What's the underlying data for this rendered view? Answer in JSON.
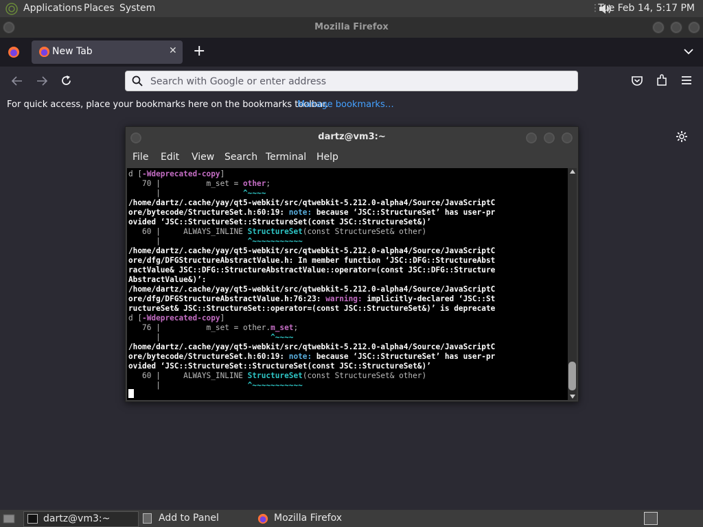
{
  "top_panel": {
    "applications": "Applications",
    "places": "Places",
    "system": "System",
    "clock": "Tue Feb 14,  5:17 PM"
  },
  "firefox": {
    "window_title": "Mozilla Firefox",
    "tab_label": "New Tab",
    "url_placeholder": "Search with Google or enter address",
    "bookmarks_text": "For quick access, place your bookmarks here on the bookmarks toolbar.",
    "manage_bookmarks": "Manage bookmarks…"
  },
  "terminal": {
    "title": "dartz@vm3:~",
    "menu": [
      "File",
      "Edit",
      "View",
      "Search",
      "Terminal",
      "Help"
    ],
    "lines": [
      "d [-Wdeprecated-copy]",
      "   70 |          m_set = other;",
      "      |                  ^~~~~",
      "/home/dartz/.cache/yay/qt5-webkit/src/qtwebkit-5.212.0-alpha4/Source/JavaScriptC",
      "ore/bytecode/StructureSet.h:60:19: note: because ‘JSC::StructureSet’ has user-pr",
      "ovided ‘JSC::StructureSet::StructureSet(const JSC::StructureSet&)’",
      "   60 |     ALWAYS_INLINE StructureSet(const StructureSet& other)",
      "      |                   ^~~~~~~~~~~~",
      "/home/dartz/.cache/yay/qt5-webkit/src/qtwebkit-5.212.0-alpha4/Source/JavaScriptC",
      "ore/dfg/DFGStructureAbstractValue.h: In member function ‘JSC::DFG::StructureAbst",
      "ractValue& JSC::DFG::StructureAbstractValue::operator=(const JSC::DFG::Structure",
      "AbstractValue&)’:",
      "/home/dartz/.cache/yay/qt5-webkit/src/qtwebkit-5.212.0-alpha4/Source/JavaScriptC",
      "ore/dfg/DFGStructureAbstractValue.h:76:23: warning: implicitly-declared ‘JSC::St",
      "ructureSet& JSC::StructureSet::operator=(const JSC::StructureSet&)’ is deprecate",
      "d [-Wdeprecated-copy]",
      "   76 |          m_set = other.m_set;",
      "      |                        ^~~~~",
      "/home/dartz/.cache/yay/qt5-webkit/src/qtwebkit-5.212.0-alpha4/Source/JavaScriptC",
      "ore/bytecode/StructureSet.h:60:19: note: because ‘JSC::StructureSet’ has user-pr",
      "ovided ‘JSC::StructureSet::StructureSet(const JSC::StructureSet&)’",
      "   60 |     ALWAYS_INLINE StructureSet(const StructureSet& other)",
      "      |                   ^~~~~~~~~~~~"
    ]
  },
  "bottom_panel": {
    "task_terminal": "dartz@vm3:~",
    "task_add_panel": "Add to Panel",
    "task_firefox": "Mozilla Firefox"
  },
  "colors": {
    "accent_link": "#45a1ff",
    "terminal_bg": "#000000"
  }
}
